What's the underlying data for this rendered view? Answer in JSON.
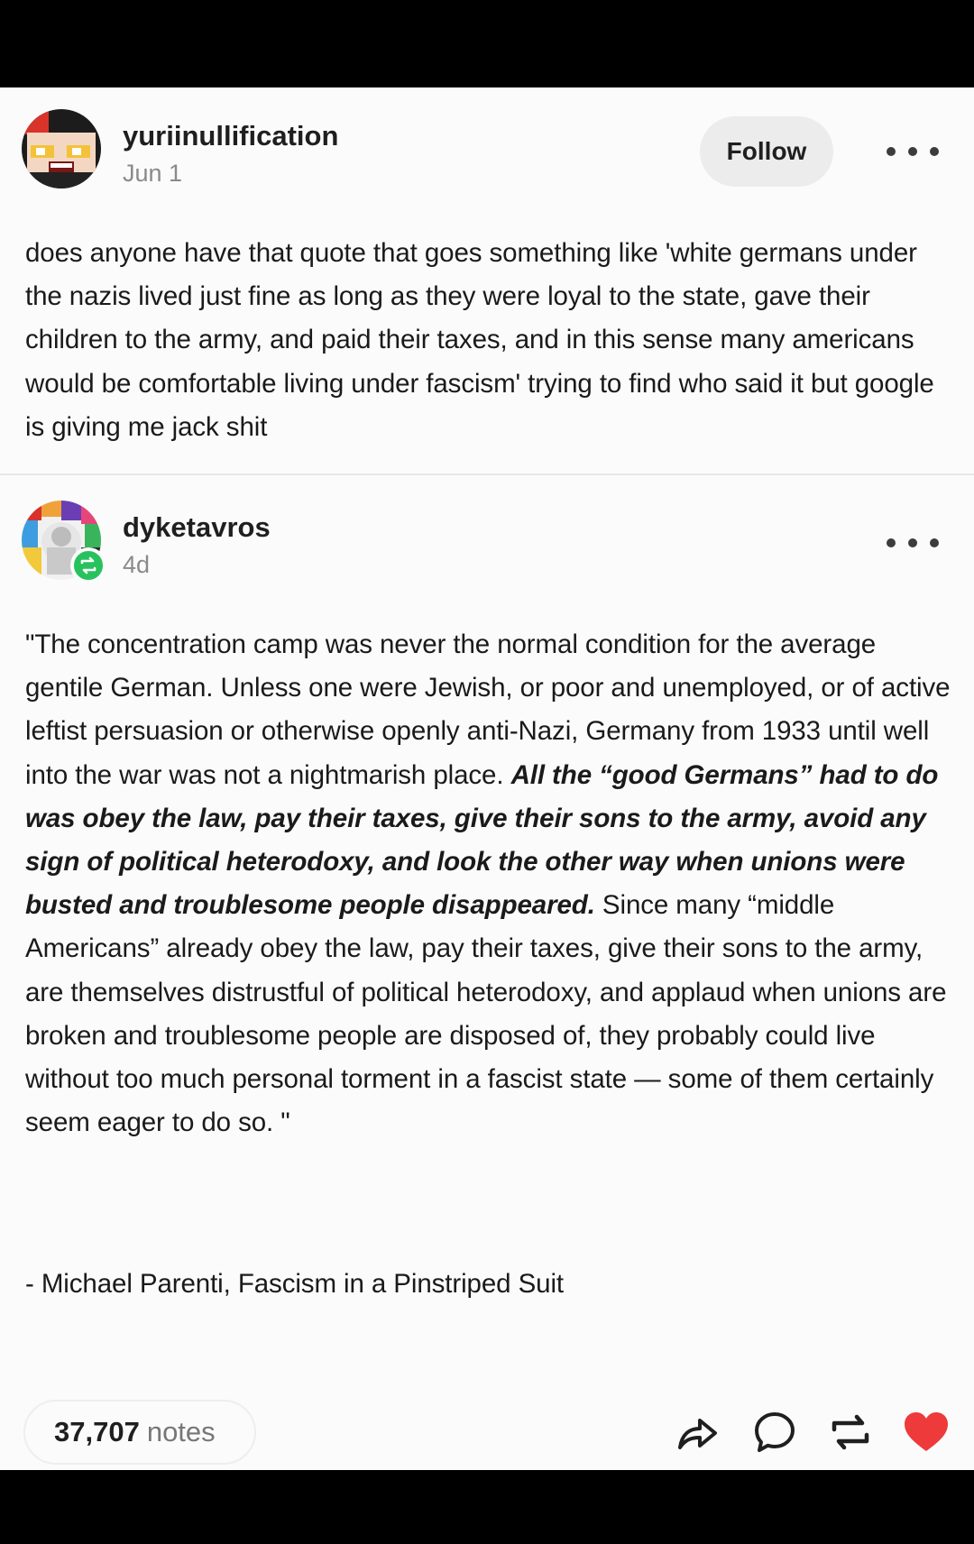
{
  "post1": {
    "username": "yuriinullification",
    "time": "Jun 1",
    "follow_label": "Follow",
    "text": "does anyone have that quote that goes something like 'white germans under the nazis lived just fine as long as they were loyal to the state, gave their children to the army, and paid their taxes, and in this sense many americans would be comfortable living under fascism' trying to find who said it but google is giving me jack shit"
  },
  "post2": {
    "username": "dyketavros",
    "time": "4d",
    "quote_intro": "\"The concentration camp was never the normal condition for the average gentile German. Unless one were Jewish, or poor and unemployed, or of active leftist persuasion or otherwise openly anti-Nazi, Germany from 1933 until well into the war was not a nightmarish place. ",
    "quote_bold": "All the “good Germans” had to do was obey the law, pay their taxes, give their sons to the army, avoid any sign of political heterodoxy, and look the other way when unions were busted and troublesome people disappeared.",
    "quote_rest": " Since many “middle Americans” already obey the law, pay their taxes, give their sons to the army, are themselves distrustful of political heterodoxy, and applaud when unions are broken and troublesome people are disposed of, they probably could live without too much personal torment in a fascist state — some of them certainly seem eager to do so. \"",
    "attribution": "- Michael Parenti, Fascism in a Pinstriped Suit"
  },
  "footer": {
    "notes_count": "37,707",
    "notes_label": "notes",
    "icons": [
      "share-icon",
      "reply-icon",
      "reblog-icon",
      "like-heart-icon"
    ],
    "like_color": "#ee3a3a"
  }
}
